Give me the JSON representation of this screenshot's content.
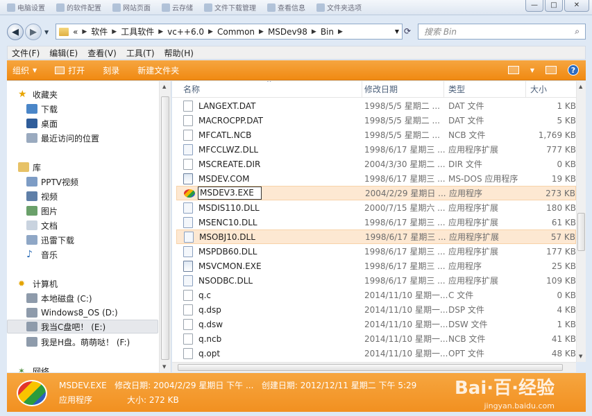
{
  "window": {
    "tasks": [
      "电脑设置",
      "的软件配置",
      "网站页面",
      "云存储",
      "文件下载管理",
      "查看信息",
      "文件夹选项"
    ],
    "min": "—",
    "max": "□",
    "close": "✕"
  },
  "address": {
    "prefix": "«",
    "crumbs": [
      "软件",
      "工具软件",
      "vc++6.0",
      "Common",
      "MSDev98",
      "Bin"
    ],
    "search_placeholder": "搜索 Bin"
  },
  "menu": [
    "文件(F)",
    "编辑(E)",
    "查看(V)",
    "工具(T)",
    "帮助(H)"
  ],
  "toolbar": {
    "organize": "组织",
    "open": "打开",
    "burn": "刻录",
    "new_folder": "新建文件夹",
    "help": "?"
  },
  "sidebar": {
    "favorites": "收藏夹",
    "fav_items": [
      "下载",
      "桌面",
      "最近访问的位置"
    ],
    "libraries": "库",
    "lib_items": [
      "PPTV视频",
      "视频",
      "图片",
      "文档",
      "迅雷下载",
      "音乐"
    ],
    "computer": "计算机",
    "drives": [
      "本地磁盘 (C:)",
      "Windows8_OS (D:)",
      "我当C盘吧！ (E:)",
      "我是H盘。萌萌哒！ (F:)"
    ],
    "network": "网络"
  },
  "columns": {
    "name": "名称",
    "date": "修改日期",
    "type": "类型",
    "size": "大小"
  },
  "files": [
    {
      "name": "LANGEXT.DAT",
      "date": "1998/5/5 星期二 ...",
      "type": "DAT 文件",
      "size": "1 KB",
      "icon": "file"
    },
    {
      "name": "MACROCPP.DAT",
      "date": "1998/5/5 星期二 ...",
      "type": "DAT 文件",
      "size": "5 KB",
      "icon": "file"
    },
    {
      "name": "MFCATL.NCB",
      "date": "1998/5/5 星期二 ...",
      "type": "NCB 文件",
      "size": "1,769 KB",
      "icon": "file"
    },
    {
      "name": "MFCCLWZ.DLL",
      "date": "1998/6/17 星期三 ...",
      "type": "应用程序扩展",
      "size": "777 KB",
      "icon": "dll"
    },
    {
      "name": "MSCREATE.DIR",
      "date": "2004/3/30 星期二 ...",
      "type": "DIR 文件",
      "size": "0 KB",
      "icon": "file"
    },
    {
      "name": "MSDEV.COM",
      "date": "1998/6/17 星期三 ...",
      "type": "MS-DOS 应用程序",
      "size": "19 KB",
      "icon": "exe"
    },
    {
      "name": "MSDEV3.EXE",
      "date": "2004/2/29 星期日 ...",
      "type": "应用程序",
      "size": "273 KB",
      "icon": "vc",
      "selected": true,
      "editing": true
    },
    {
      "name": "MSDIS110.DLL",
      "date": "2000/7/15 星期六 ...",
      "type": "应用程序扩展",
      "size": "180 KB",
      "icon": "dll"
    },
    {
      "name": "MSENC10.DLL",
      "date": "1998/6/17 星期三 ...",
      "type": "应用程序扩展",
      "size": "61 KB",
      "icon": "dll"
    },
    {
      "name": "MSOBJ10.DLL",
      "date": "1998/6/17 星期三 ...",
      "type": "应用程序扩展",
      "size": "57 KB",
      "icon": "dll",
      "selected": true
    },
    {
      "name": "MSPDB60.DLL",
      "date": "1998/6/17 星期三 ...",
      "type": "应用程序扩展",
      "size": "177 KB",
      "icon": "dll"
    },
    {
      "name": "MSVCMON.EXE",
      "date": "1998/6/17 星期三 ...",
      "type": "应用程序",
      "size": "25 KB",
      "icon": "exe"
    },
    {
      "name": "NSODBC.DLL",
      "date": "1998/6/17 星期三 ...",
      "type": "应用程序扩展",
      "size": "109 KB",
      "icon": "dll"
    },
    {
      "name": "q.c",
      "date": "2014/11/10 星期一...",
      "type": "C 文件",
      "size": "0 KB",
      "icon": "file"
    },
    {
      "name": "q.dsp",
      "date": "2014/11/10 星期一...",
      "type": "DSP 文件",
      "size": "4 KB",
      "icon": "file"
    },
    {
      "name": "q.dsw",
      "date": "2014/11/10 星期一...",
      "type": "DSW 文件",
      "size": "1 KB",
      "icon": "file"
    },
    {
      "name": "q.ncb",
      "date": "2014/11/10 星期一...",
      "type": "NCB 文件",
      "size": "41 KB",
      "icon": "file"
    },
    {
      "name": "q.opt",
      "date": "2014/11/10 星期一...",
      "type": "OPT 文件",
      "size": "48 KB",
      "icon": "file"
    }
  ],
  "details": {
    "filename": "MSDEV.EXE",
    "modified_label": "修改日期:",
    "modified": "2004/2/29 星期日 下午 ...",
    "created_label": "创建日期:",
    "created": "2012/12/11 星期二 下午 5:29",
    "type": "应用程序",
    "size_label": "大小:",
    "size": "272 KB"
  },
  "watermark": {
    "main": "Bai·百·经验",
    "sub": "jingyan.baidu.com"
  },
  "colors": {
    "accent": "#F08A12",
    "selection": "#FDE8D2"
  }
}
